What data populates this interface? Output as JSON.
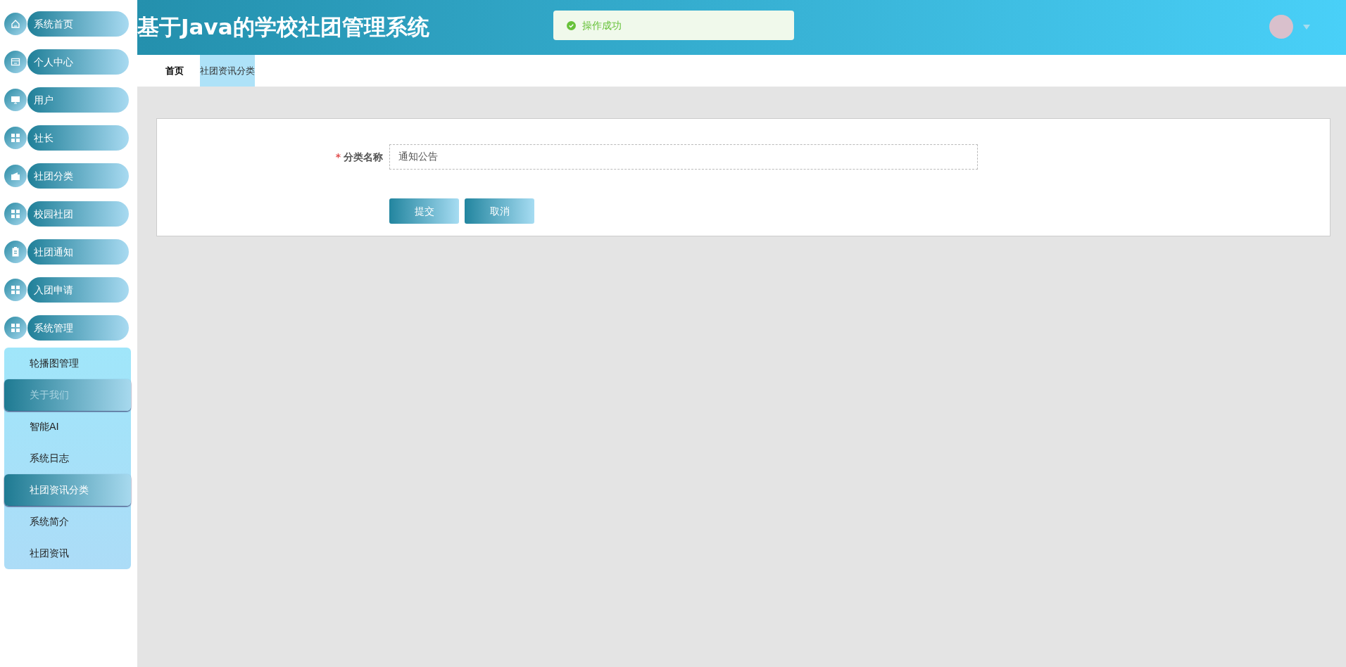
{
  "header": {
    "title": "基于Java的学校社团管理系统",
    "toast": {
      "kind": "success",
      "message": "操作成功"
    }
  },
  "sidebar": {
    "items": [
      {
        "label": "系统首页"
      },
      {
        "label": "个人中心"
      },
      {
        "label": "用户"
      },
      {
        "label": "社长"
      },
      {
        "label": "社团分类"
      },
      {
        "label": "校园社团"
      },
      {
        "label": "社团通知"
      },
      {
        "label": "入团申请"
      },
      {
        "label": "系统管理",
        "children": [
          {
            "label": "轮播图管理",
            "selected": false,
            "hovered": false
          },
          {
            "label": "关于我们",
            "selected": false,
            "hovered": true
          },
          {
            "label": "智能AI",
            "selected": false,
            "hovered": false
          },
          {
            "label": "系统日志",
            "selected": false,
            "hovered": false
          },
          {
            "label": "社团资讯分类",
            "selected": true,
            "hovered": false
          },
          {
            "label": "系统简介",
            "selected": false,
            "hovered": false
          },
          {
            "label": "社团资讯",
            "selected": false,
            "hovered": false
          }
        ]
      }
    ]
  },
  "tabs": [
    {
      "label": "首页",
      "selected": false
    },
    {
      "label": "社团资讯分类",
      "selected": true
    }
  ],
  "form": {
    "fields": [
      {
        "label": "分类名称",
        "required_mark": "*",
        "value": "通知公告"
      }
    ],
    "buttons": [
      "提交",
      "取消"
    ]
  }
}
